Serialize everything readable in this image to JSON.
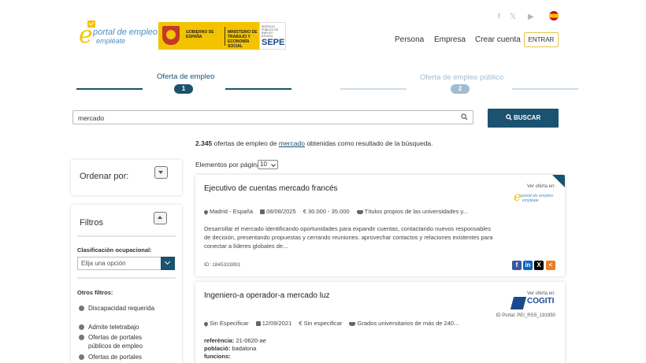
{
  "header": {
    "portal_logo": {
      "line1": "portal de empleo",
      "line2": "empléate",
      "letter": "e"
    },
    "gov_logo": {
      "left": "GOBIERNO DE ESPAÑA",
      "right": "MINISTERIO DE TRABAJO Y ECONOMÍA SOCIAL"
    },
    "sepe_logo": {
      "small": "SERVICIO PÚBLICO DE EMPLEO ESTATAL",
      "big": "SEPE"
    },
    "social": {
      "facebook": "f",
      "x": "𝕏",
      "youtube": "▶"
    },
    "nav": {
      "persona": "Persona",
      "empresa": "Empresa",
      "crear_cuenta": "Crear cuenta",
      "entrar": "ENTRAR"
    }
  },
  "tabs": [
    {
      "label": "Oferta de empleo",
      "number": "1",
      "active": true
    },
    {
      "label": "Oferta de empleo público",
      "number": "2",
      "active": false
    }
  ],
  "search": {
    "value": "mercado",
    "button_label": "BUSCAR"
  },
  "results": {
    "count": "2.345",
    "text_before": " ofertas de empleo de ",
    "keyword": "mercado",
    "text_after": " obtenidas como resultado de la búsqueda.",
    "per_page_label": "Elementos por página",
    "per_page_value": "10"
  },
  "sidebar": {
    "sort_title": "Ordenar por:",
    "filters_title": "Filtros",
    "classification_label": "Clasificación ocupacional:",
    "classification_placeholder": "Elija una opción",
    "other_filters_label": "Otros filtros:",
    "other_filters": [
      "Discapacidad requerida",
      "Admite teletrabajo",
      "Ofertas de portales públicos de empleo",
      "Ofertas de portales"
    ]
  },
  "offers": [
    {
      "title": "Ejecutivo de cuentas mercado francés",
      "location": "Madrid - España",
      "date": "08/08/2025",
      "salary": "30.000 - 35.000",
      "education": "Títulos propios de las universidades y...",
      "description": "Desarrollar el mercado identificando oportunidades para expandir cuentas, contactando nuevos responsables de decisión, presentando propuestas y cerrando reuniones. aprovechar contactos y relaciones existentes para conectar a líderes globales de...",
      "id_label": "ID: 1845333891",
      "source_label": "Ver oferta en:",
      "source_logo_line1": "portal de empleo",
      "source_logo_line2": "empléate"
    },
    {
      "title": "Ingeniero-a operador-a mercado luz",
      "location": "Sin Especificar",
      "date": "12/09/2021",
      "salary": "Sin especificar",
      "education": "Grados universitarios de más de 240...",
      "source_label": "Ver oferta en:",
      "source_name": "COGITI",
      "portal_id": "ID Portal: PEI_RSS_191950",
      "details": [
        {
          "key": "referència:",
          "value": " 21-0620-ae"
        },
        {
          "key": "població:",
          "value": " badalona"
        },
        {
          "key": "funcions:",
          "value": ""
        }
      ]
    }
  ],
  "colors": {
    "primary": "#1a5270",
    "accent": "#f2c400",
    "inactive_tab": "#9fbdd2"
  }
}
